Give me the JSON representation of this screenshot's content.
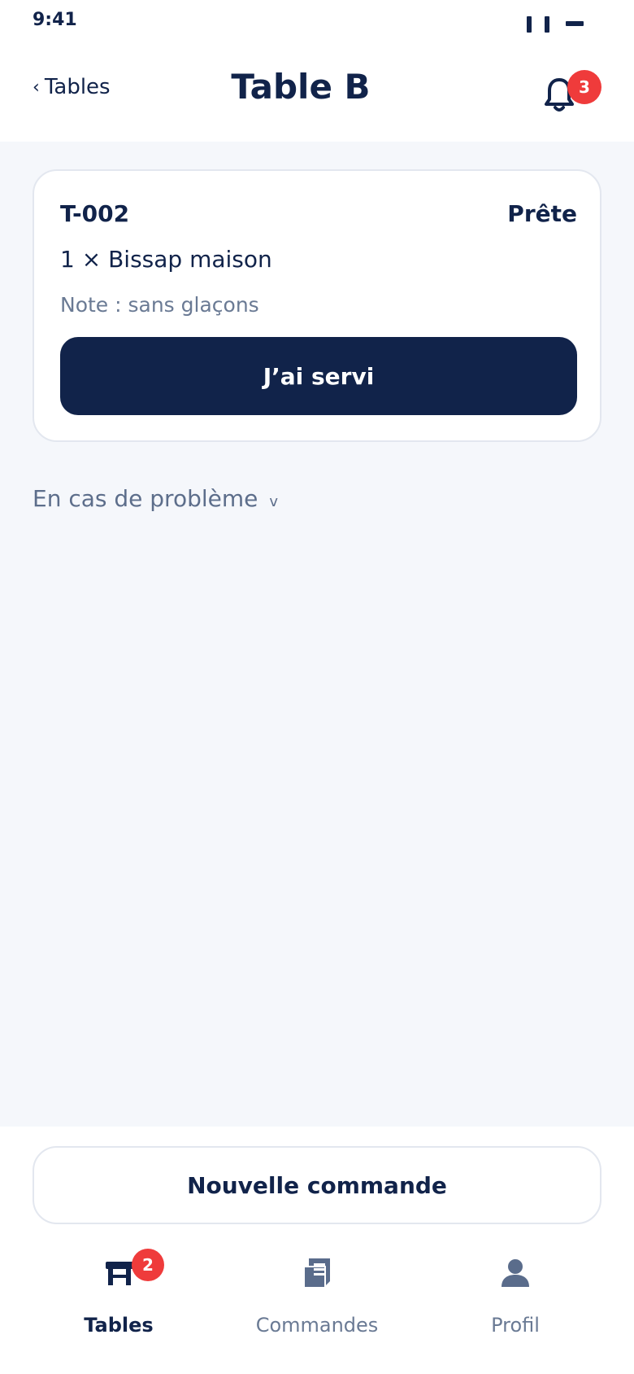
{
  "status_bar": {
    "time": "9:41"
  },
  "header": {
    "back_label": "Tables",
    "title": "Table B",
    "notification_count": "3"
  },
  "order": {
    "id": "T-002",
    "status": "Prête",
    "item": "1 × Bissap maison",
    "note": "Note : sans glaçons",
    "served_label": "J’ai servi"
  },
  "problem": {
    "label": "En cas de problème"
  },
  "bottom": {
    "new_order_label": "Nouvelle commande"
  },
  "tabs": [
    {
      "label": "Tables",
      "badge": "2",
      "icon": "table-icon",
      "active": true
    },
    {
      "label": "Commandes",
      "icon": "receipt-icon",
      "active": false
    },
    {
      "label": "Profil",
      "icon": "person-icon",
      "active": false
    }
  ],
  "colors": {
    "primary": "#11234A",
    "badge": "#EF3B3B",
    "muted": "#6A7A94",
    "background": "#F5F7FB"
  }
}
